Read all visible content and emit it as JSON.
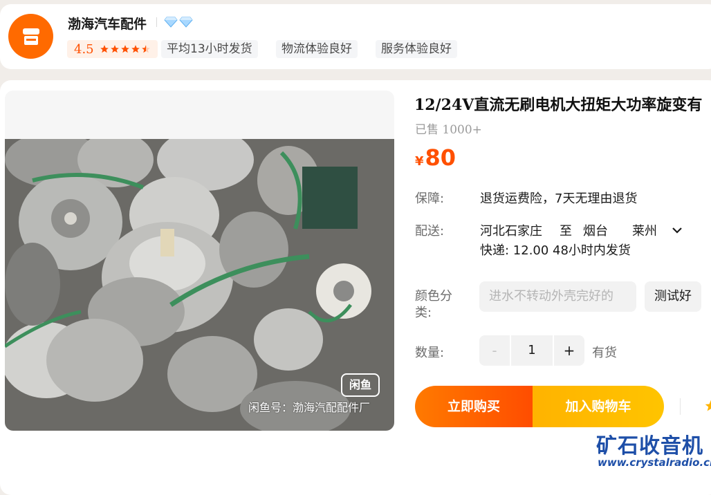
{
  "shop": {
    "name": "渤海汽车配件",
    "rating": "4.5",
    "stars": 4.5,
    "tags": [
      "平均13小时发货",
      "物流体验良好",
      "服务体验良好"
    ],
    "badge_icon": "diamond-icon"
  },
  "gallery": {
    "watermark_badge": "闲鱼",
    "watermark_text": "闲鱼号：渤海汽配配件厂"
  },
  "product": {
    "title": "12/24V直流无刷电机大扭矩大功率旋变有",
    "sold": "已售 1000+",
    "currency": "¥",
    "price": "80"
  },
  "details": {
    "guarantee_label": "保障:",
    "guarantee_value": "退货运费险，7天无理由退货",
    "shipping_label": "配送:",
    "from": "河北石家庄",
    "to_word": "至",
    "dest_city": "烟台",
    "dest_district": "莱州",
    "express": "快递: 12.00",
    "ship_time": "48小时内发货",
    "color_label": "颜色分类:",
    "options": [
      {
        "label": "进水不转动外壳完好的",
        "disabled": true
      },
      {
        "label": "测试好",
        "disabled": false
      }
    ],
    "qty_label": "数量:",
    "qty_minus": "-",
    "qty_value": "1",
    "qty_plus": "+",
    "stock": "有货"
  },
  "actions": {
    "buy_now": "立即购买",
    "add_cart": "加入购物车"
  },
  "site_watermark": {
    "name": "矿石收音机",
    "url": "www.crystalradio.cn"
  },
  "colors": {
    "accent": "#ff5000",
    "buy_gradient": [
      "#ff7a00",
      "#ff4d00"
    ],
    "cart_gradient": [
      "#ffb300",
      "#ffc400"
    ],
    "watermark": "#1e4fa8"
  }
}
